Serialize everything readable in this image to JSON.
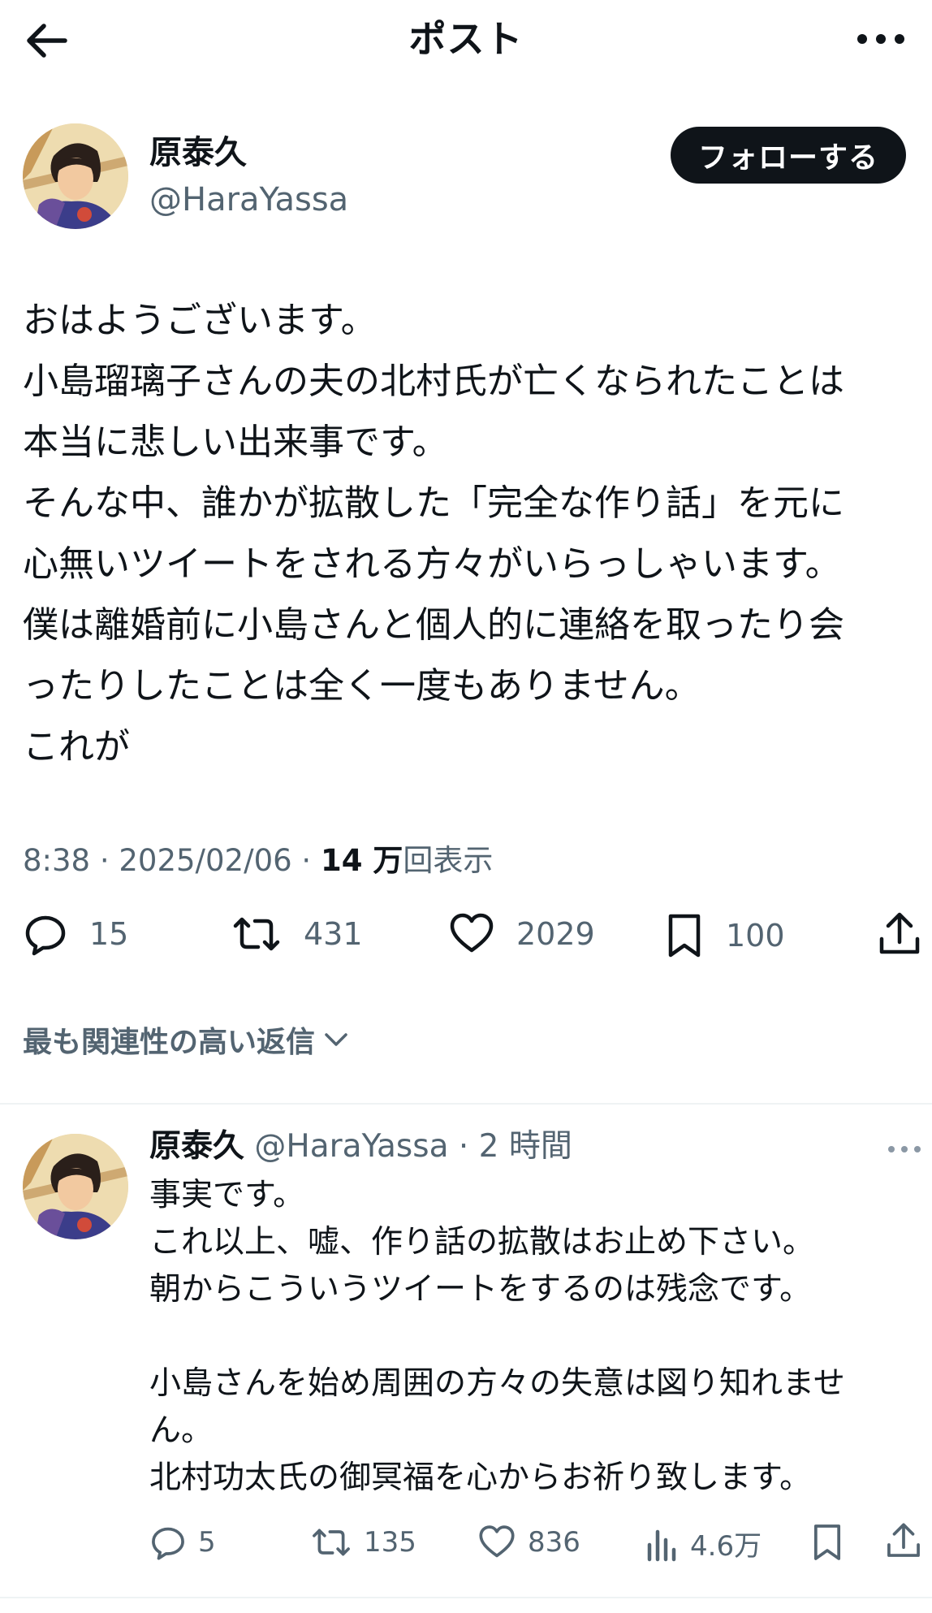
{
  "header": {
    "title": "ポスト",
    "back_icon": "arrow-left-icon",
    "more_icon": "more-horizontal-icon"
  },
  "post": {
    "author": {
      "name": "原泰久",
      "handle": "@HaraYassa",
      "follow_label": "フォローする"
    },
    "body": "おはようございます。\n小島瑠璃子さんの夫の北村氏が亡くなられたことは\n本当に悲しい出来事です。\nそんな中、誰かが拡散した「完全な作り話」を元に\n心無いツイートをされる方々がいらっしゃいます。\n僕は離婚前に小島さんと個人的に連絡を取ったり会\nったりしたことは全く一度もありません。\nこれが",
    "meta": {
      "time": "8:38",
      "sep1": " · ",
      "date": "2025/02/06",
      "sep2": " · ",
      "views": "14 万",
      "views_label": "回表示"
    },
    "actions": {
      "replies": "15",
      "reposts": "431",
      "likes": "2029",
      "bookmarks": "100"
    }
  },
  "replies_sort": {
    "label": "最も関連性の高い返信"
  },
  "reply": {
    "name": "原泰久",
    "handle": "@HaraYassa",
    "time": "· 2 時間",
    "body": "事実です。\nこれ以上、嘘、作り話の拡散はお止め下さい。\n朝からこういうツイートをするのは残念です。\n\n小島さんを始め周囲の方々の失意は図り知れませ\nん。\n北村功太氏の御冥福を心からお祈り致します。",
    "actions": {
      "replies": "5",
      "reposts": "135",
      "likes": "836",
      "views": "4.6万"
    }
  },
  "colors": {
    "text": "#0f1419",
    "secondary": "#536471",
    "follow_bg": "#0f1419",
    "divider": "#eff3f4"
  }
}
